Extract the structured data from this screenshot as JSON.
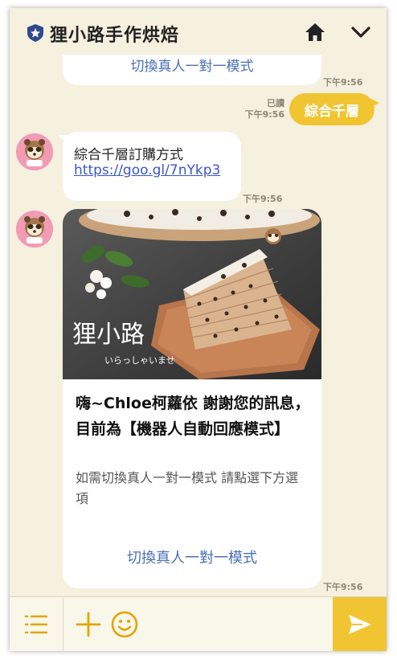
{
  "header": {
    "room_name": "狸小路手作烘焙",
    "icons": [
      "shield-star-icon",
      "home-icon",
      "chevron-down-icon"
    ]
  },
  "messages": {
    "partial_top": {
      "action_label": "切換真人一對一模式",
      "time": "下午9:56"
    },
    "sent": {
      "text": "綜合千層",
      "read_label": "已讀",
      "time": "下午9:56"
    },
    "reply": {
      "line1": "綜合千層訂購方式",
      "link": "https://goo.gl/7nYkp3",
      "time": "下午9:56"
    },
    "card": {
      "title": "嗨~Chloe柯蘿依 謝謝您的訊息，目前為【機器人自動回應模式】",
      "description": "如需切換真人一對一模式 請點選下方選項",
      "action_label": "切換真人一對一模式",
      "image_brand": "狸小路",
      "image_caption": "いらっしゃいませ",
      "time": "下午9:56"
    }
  },
  "input": {
    "placeholder": ""
  },
  "colors": {
    "accent": "#f1c531",
    "background": "#f6f0df",
    "link": "#3a57c9",
    "action": "#4a6fb5"
  }
}
